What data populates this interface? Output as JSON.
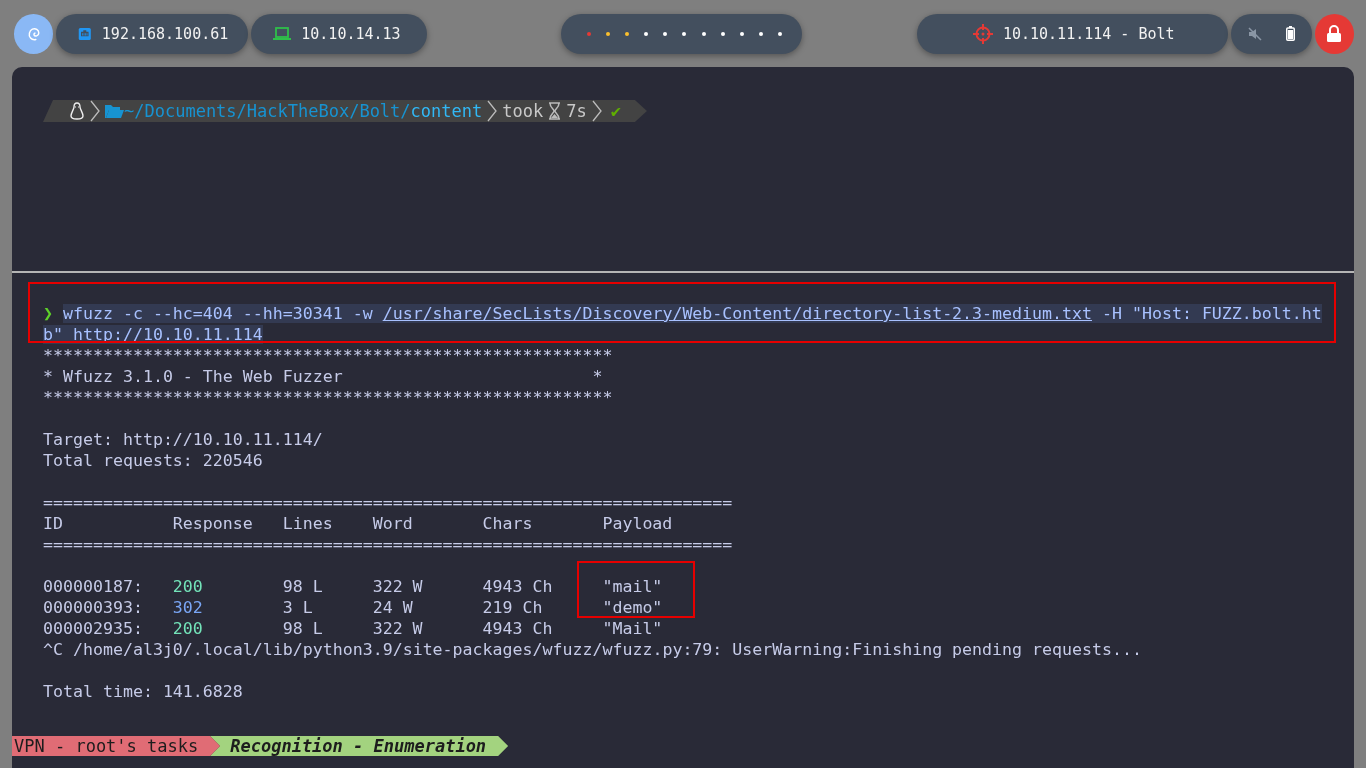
{
  "top_bar": {
    "ethernet_ip": "192.168.100.61",
    "vpn_ip": "10.10.14.13",
    "workspaces": [
      {
        "color": "#e53935"
      },
      {
        "color": "#fbc02d"
      },
      {
        "color": "#fbc02d"
      },
      {
        "color": "#ffffff"
      },
      {
        "color": "#ffffff"
      },
      {
        "color": "#ffffff"
      },
      {
        "color": "#ffffff"
      },
      {
        "color": "#ffffff"
      },
      {
        "color": "#ffffff"
      },
      {
        "color": "#ffffff"
      },
      {
        "color": "#ffffff"
      }
    ],
    "target": "10.10.11.114 - Bolt"
  },
  "prompt": {
    "path": "~/Documents/HackTheBox/Bolt/",
    "current_dir": "content",
    "took_label": "took",
    "duration": "7s",
    "status": "✔"
  },
  "command": {
    "symbol": "❯",
    "before": "wfuzz -c --hc=404 --hh=30341 -w ",
    "wordlist": "/usr/share/SecLists/Discovery/Web-Content/directory-list-2.3-medium.txt",
    "after": " -H \"Host: FUZZ.bolt.htb\" http://10.10.11.114",
    "highlighted": true
  },
  "banner": [
    "*********************************************************",
    "* Wfuzz 3.1.0 - The Web Fuzzer                         *",
    "*********************************************************"
  ],
  "info": [
    "Target: http://10.10.11.114/",
    "Total requests: 220546"
  ],
  "rule": "=====================================================================",
  "table": {
    "columns": [
      "ID",
      "Response",
      "Lines",
      "Word",
      "Chars",
      "Payload"
    ],
    "rows": [
      {
        "id": "000000187:",
        "response": "200",
        "color": "#73e3b9",
        "lines": "98 L",
        "word": "322 W",
        "chars": "4943 Ch",
        "payload": "\"mail\"",
        "highlighted": true
      },
      {
        "id": "000000393:",
        "response": "302",
        "color": "#7aa6f5",
        "lines": "3 L",
        "word": "24 W",
        "chars": "219 Ch",
        "payload": "\"demo\"",
        "highlighted": true
      },
      {
        "id": "000002935:",
        "response": "200",
        "color": "#73e3b9",
        "lines": "98 L",
        "word": "322 W",
        "chars": "4943 Ch",
        "payload": "\"Mail\"",
        "highlighted": false
      }
    ]
  },
  "warning": "^C /home/al3j0/.local/lib/python3.9/site-packages/wfuzz/wfuzz.py:79: UserWarning:Finishing pending requests...",
  "total_time": "Total time: 141.6828",
  "status_bar": {
    "session": "VPN - root's tasks",
    "window": "Recognition - Enumeration"
  }
}
